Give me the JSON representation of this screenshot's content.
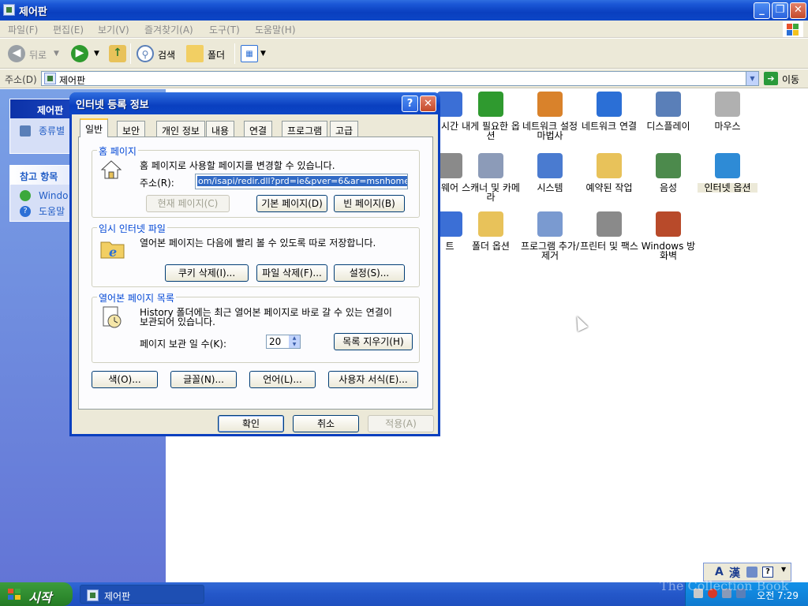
{
  "window": {
    "title": "제어판"
  },
  "menu": [
    "파일(F)",
    "편집(E)",
    "보기(V)",
    "즐겨찾기(A)",
    "도구(T)",
    "도움말(H)"
  ],
  "toolbar": {
    "back": "뒤로",
    "search": "검색",
    "folders": "폴더"
  },
  "address": {
    "label": "주소(D)",
    "value": "제어판",
    "go": "이동"
  },
  "left_pane": {
    "cp_title": "제어판",
    "switch_view": "종류별",
    "see_also_title": "참고 항목",
    "see_also": [
      "Windo",
      "도움말"
    ]
  },
  "icons": [
    {
      "label": "시간",
      "color": "#3b6fd6"
    },
    {
      "label": "내게 필요한 옵션",
      "color": "#2f9a2f"
    },
    {
      "label": "네트워크 설정 마법사",
      "color": "#d9822b"
    },
    {
      "label": "네트워크 연결",
      "color": "#2b6fd6"
    },
    {
      "label": "디스플레이",
      "color": "#5a7fb8"
    },
    {
      "label": "마우스",
      "color": "#b0b0b0"
    },
    {
      "label": "웨어",
      "color": "#8a8a8a"
    },
    {
      "label": "스캐너 및 카메라",
      "color": "#8c9bb8"
    },
    {
      "label": "시스템",
      "color": "#4a7bd0"
    },
    {
      "label": "예약된 작업",
      "color": "#e8c25a"
    },
    {
      "label": "음성",
      "color": "#4c8a4c"
    },
    {
      "label": "인터넷 옵션",
      "color": "#2e8bd6"
    },
    {
      "label": "트",
      "color": "#3b6fd6"
    },
    {
      "label": "폴더 옵션",
      "color": "#e8c25a"
    },
    {
      "label": "프로그램 추가/제거",
      "color": "#7a9ad0"
    },
    {
      "label": "프린터 및 팩스",
      "color": "#8a8a8a"
    },
    {
      "label": "Windows 방화벽",
      "color": "#b84a2a"
    }
  ],
  "dialog": {
    "title": "인터넷 등록 정보",
    "help": "?",
    "close": "X",
    "tabs": [
      "일반",
      "보안",
      "개인 정보",
      "내용",
      "연결",
      "프로그램",
      "고급"
    ],
    "home": {
      "group": "홈 페이지",
      "desc": "홈 페이지로 사용할 페이지를 변경할 수 있습니다.",
      "addr_label": "주소(R):",
      "addr_value": "om/isapi/redir.dll?prd=ie&pver=6&ar=msnhome",
      "btn_current": "현재 페이지(C)",
      "btn_default": "기본 페이지(D)",
      "btn_blank": "빈 페이지(B)"
    },
    "temp": {
      "group": "임시 인터넷 파일",
      "desc": "열어본 페이지는 다음에 빨리 볼 수 있도록 따로 저장합니다.",
      "btn_cookies": "쿠키 삭제(I)...",
      "btn_files": "파일 삭제(F)...",
      "btn_settings": "설정(S)..."
    },
    "history": {
      "group": "열어본 페이지 목록",
      "desc1": "History 폴더에는 최근 열어본 페이지로 바로 갈 수 있는 연결이",
      "desc2": "보관되어 있습니다.",
      "days_label": "페이지 보관 일 수(K):",
      "days_value": "20",
      "btn_clear": "목록 지우기(H)"
    },
    "bottom": {
      "colors": "색(O)...",
      "fonts": "글꼴(N)...",
      "languages": "언어(L)...",
      "accessibility": "사용자 서식(E)..."
    },
    "actions": {
      "ok": "확인",
      "cancel": "취소",
      "apply": "적용(A)"
    }
  },
  "taskbar": {
    "start": "시작",
    "task": "제어판",
    "clock": "오전 7:29"
  },
  "ime": {
    "mode": "A",
    "hanja": "漢"
  },
  "watermark": "The Collection Book"
}
